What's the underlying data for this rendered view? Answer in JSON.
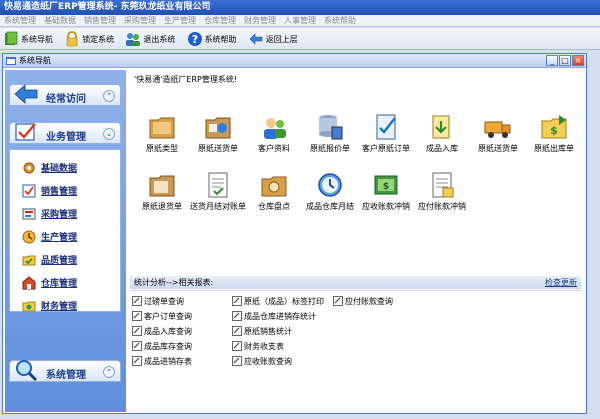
{
  "app": {
    "title": "快易通造纸厂ERP管理系统- 东莞玖龙纸业有限公司"
  },
  "menu": [
    "系统管理",
    "基础数据",
    "销售管理",
    "采购管理",
    "生产管理",
    "仓库管理",
    "财务管理",
    "人事管理",
    "系统帮助"
  ],
  "toolbar": {
    "nav_label": "系统导航",
    "lock_label": "锁定系统",
    "exit_label": "退出系统",
    "help_label": "系统帮助",
    "back_label": "返回上层"
  },
  "navwin": {
    "title": "系统导航"
  },
  "sidebar": {
    "frequent": "经常访问",
    "business": "业务管理",
    "system": "系统管理",
    "items": [
      "基础数据",
      "销售管理",
      "采购管理",
      "生产管理",
      "品质管理",
      "仓库管理",
      "财务管理"
    ]
  },
  "main": {
    "welcome": "'快易通'造纸厂ERP管理系统!",
    "modules": [
      "原纸类型",
      "原纸送货单",
      "客户资料",
      "原纸报价单",
      "客户原纸订单",
      "成品入库",
      "原纸送货单",
      "原纸出库单",
      "原纸退货单",
      "送货月结对账单",
      "仓库盘点",
      "成品仓库月结",
      "应收账款冲销",
      "应付账款冲销"
    ],
    "stats_label": "统计分析-->相关报表:",
    "view_more": "检查更新",
    "reports": [
      "过磅单查询",
      "客户订单查询",
      "成品入库查询",
      "成品库存查询",
      "成品进销存表",
      "原纸（成品）标签打印",
      "成品仓库进销存统计",
      "原纸销售统计",
      "财务收支表",
      "应收账款查询",
      "应付账款查询"
    ]
  },
  "colors": {
    "accent": "#1f4fb3",
    "sidebar": "#6f9be0"
  }
}
